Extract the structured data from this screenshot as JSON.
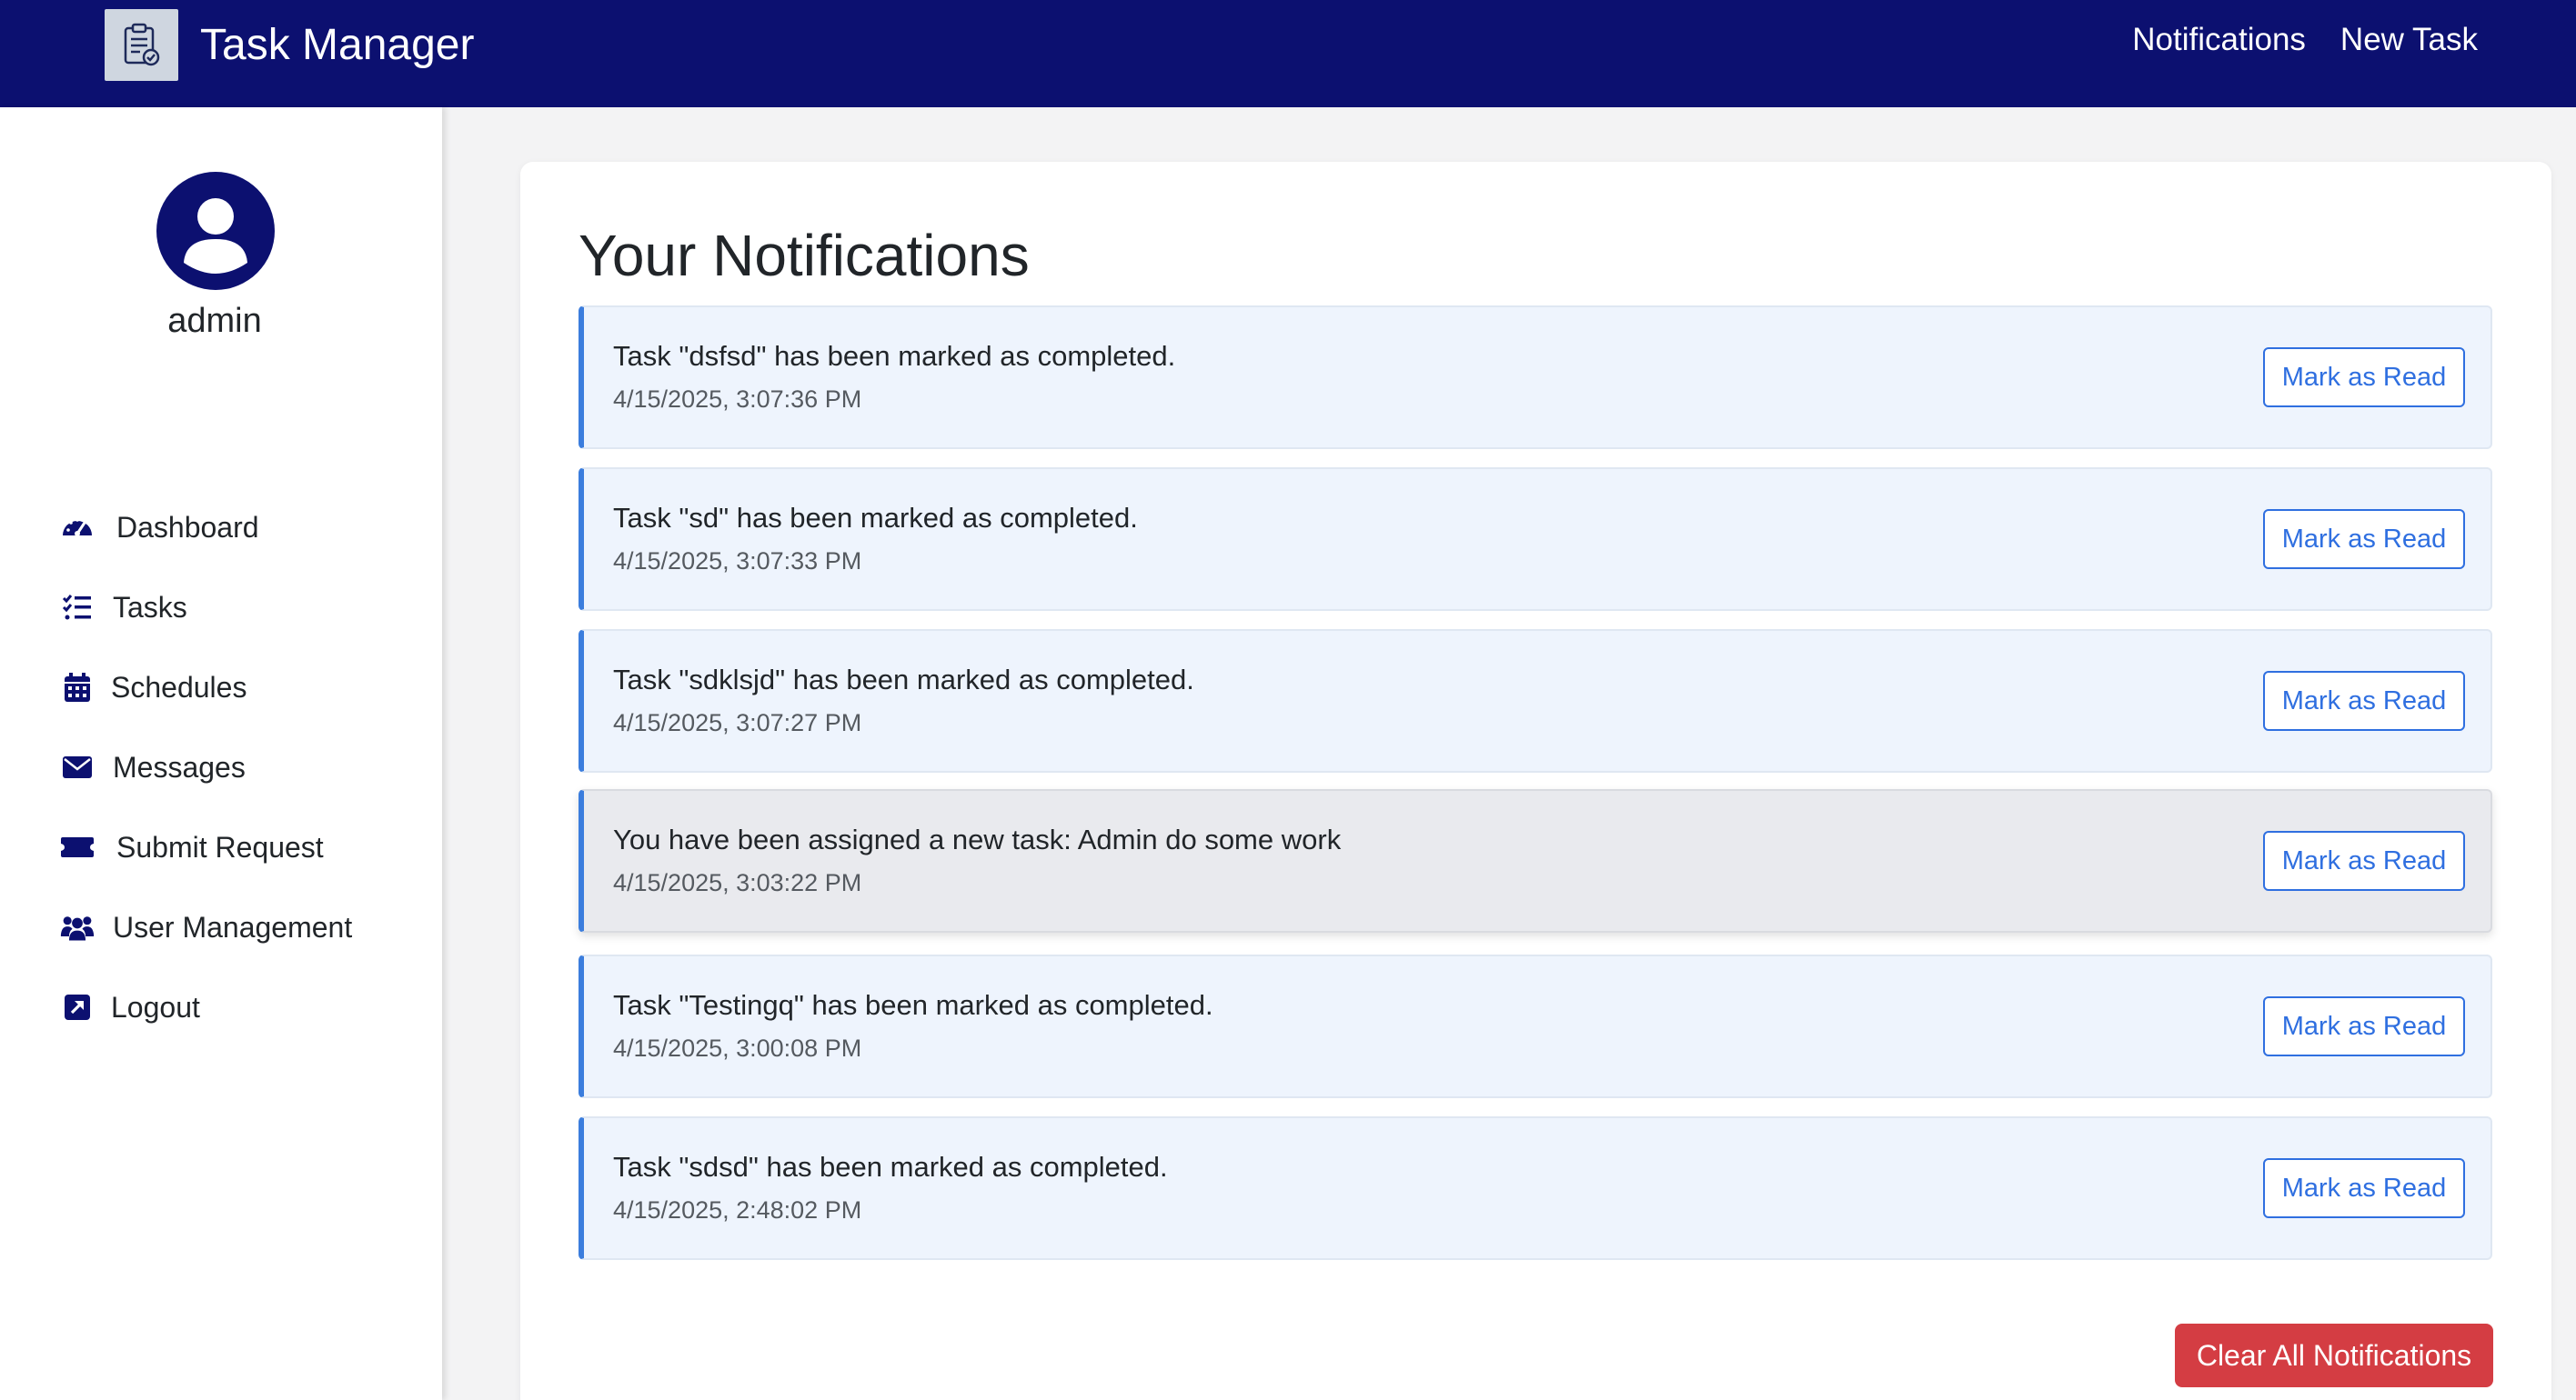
{
  "app": {
    "title": "Task Manager",
    "logo_icon": "clipboard-check-icon",
    "nav": [
      {
        "label": "Notifications"
      },
      {
        "label": "New Task"
      }
    ],
    "brand_color": "#0c1070"
  },
  "sidebar": {
    "username": "admin",
    "avatar_icon": "user-circle-icon",
    "items": [
      {
        "label": "Dashboard",
        "icon": "gauge-icon"
      },
      {
        "label": "Tasks",
        "icon": "list-check-icon"
      },
      {
        "label": "Schedules",
        "icon": "calendar-icon"
      },
      {
        "label": "Messages",
        "icon": "envelope-icon"
      },
      {
        "label": "Submit Request",
        "icon": "ticket-icon"
      },
      {
        "label": "User Management",
        "icon": "users-icon"
      },
      {
        "label": "Logout",
        "icon": "external-link-icon"
      }
    ]
  },
  "main": {
    "title": "Your Notifications",
    "mark_read_label": "Mark as Read",
    "clear_all_label": "Clear All Notifications",
    "notifications": [
      {
        "message": "Task \"dsfsd\" has been marked as completed.",
        "time": "4/15/2025, 3:07:36 PM"
      },
      {
        "message": "Task \"sd\" has been marked as completed.",
        "time": "4/15/2025, 3:07:33 PM"
      },
      {
        "message": "Task \"sdklsjd\" has been marked as completed.",
        "time": "4/15/2025, 3:07:27 PM"
      },
      {
        "message": "You have been assigned a new task: Admin do some work",
        "time": "4/15/2025, 3:03:22 PM"
      },
      {
        "message": "Task \"Testingq\" has been marked as completed.",
        "time": "4/15/2025, 3:00:08 PM"
      },
      {
        "message": "Task \"sdsd\" has been marked as completed.",
        "time": "4/15/2025, 2:48:02 PM"
      }
    ],
    "accent_color": "#3b7ddd",
    "danger_color": "#d43d43"
  }
}
